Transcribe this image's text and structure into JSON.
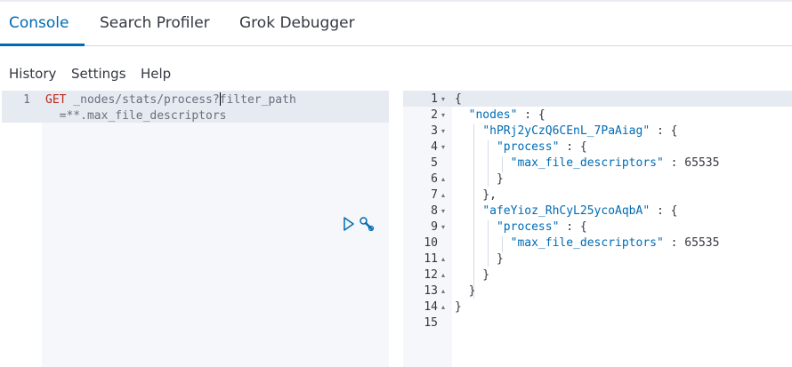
{
  "tabs": [
    {
      "label": "Console",
      "active": true
    },
    {
      "label": "Search Profiler",
      "active": false
    },
    {
      "label": "Grok Debugger",
      "active": false
    }
  ],
  "menu": {
    "history": "History",
    "settings": "Settings",
    "help": "Help"
  },
  "editor": {
    "line_number": "1",
    "method": "GET",
    "path_before_cursor": " _nodes/stats/process?",
    "path_after_cursor": "filter_path",
    "wrapped": "  =**.max_file_descriptors",
    "run_icon": "play-icon",
    "settings_icon": "wrench-icon"
  },
  "output": {
    "lines": [
      {
        "n": "1",
        "fold": "down",
        "text": "{"
      },
      {
        "n": "2",
        "fold": "down",
        "text": "  \"nodes\" : {"
      },
      {
        "n": "3",
        "fold": "down",
        "text": "    \"hPRj2yCzQ6CEnL_7PaAiag\" : {"
      },
      {
        "n": "4",
        "fold": "down",
        "text": "      \"process\" : {"
      },
      {
        "n": "5",
        "fold": "",
        "text": "        \"max_file_descriptors\" : 65535"
      },
      {
        "n": "6",
        "fold": "up",
        "text": "      }"
      },
      {
        "n": "7",
        "fold": "up",
        "text": "    },"
      },
      {
        "n": "8",
        "fold": "down",
        "text": "    \"afeYioz_RhCyL25ycoAqbA\" : {"
      },
      {
        "n": "9",
        "fold": "down",
        "text": "      \"process\" : {"
      },
      {
        "n": "10",
        "fold": "",
        "text": "        \"max_file_descriptors\" : 65535"
      },
      {
        "n": "11",
        "fold": "up",
        "text": "      }"
      },
      {
        "n": "12",
        "fold": "up",
        "text": "    }"
      },
      {
        "n": "13",
        "fold": "up",
        "text": "  }"
      },
      {
        "n": "14",
        "fold": "up",
        "text": "}"
      },
      {
        "n": "15",
        "fold": "",
        "text": ""
      }
    ]
  },
  "colors": {
    "accent": "#006bb4",
    "keyword": "#bd271e",
    "editor_bg": "#f5f7fa"
  }
}
